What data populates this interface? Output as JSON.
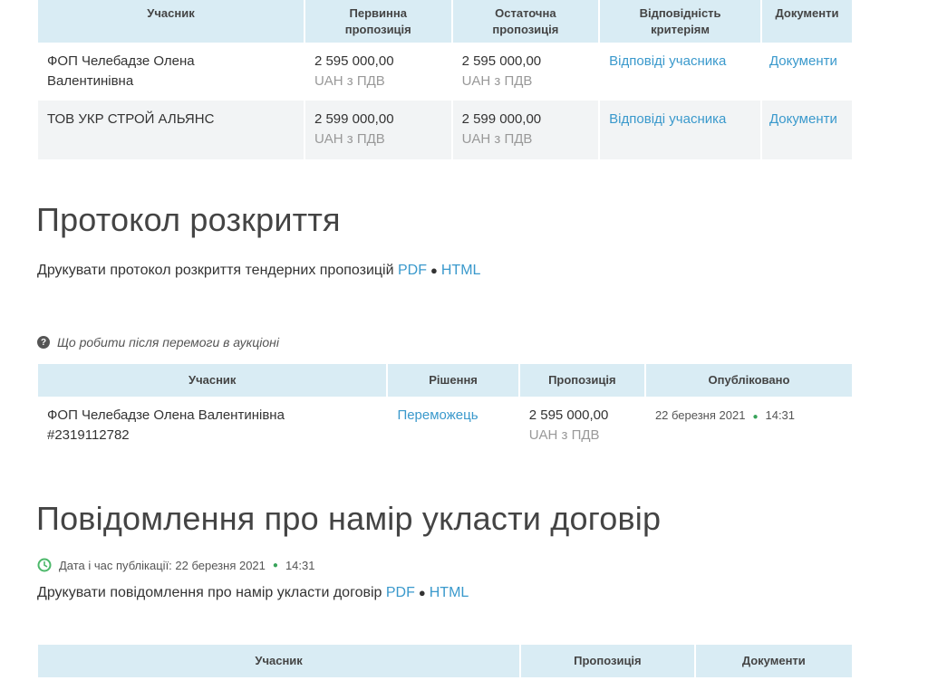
{
  "bids_table": {
    "headers": {
      "participant": "Учасник",
      "initial_1": "Первинна",
      "initial_2": "пропозиція",
      "final_1": "Остаточна",
      "final_2": "пропозиція",
      "criteria_1": "Відповідність",
      "criteria_2": "критеріям",
      "documents": "Документи"
    },
    "rows": [
      {
        "name_1": "ФОП Челебадзе Олена",
        "name_2": "Валентинівна",
        "initial": "2 595 000,00",
        "initial_vat": "UAH з ПДВ",
        "final": "2 595 000,00",
        "final_vat": "UAH з ПДВ",
        "answers": "Відповіді учасника",
        "documents": "Документи"
      },
      {
        "name_1": "ТОВ УКР СТРОЙ АЛЬЯНС",
        "name_2": "",
        "initial": "2 599 000,00",
        "initial_vat": "UAH з ПДВ",
        "final": "2 599 000,00",
        "final_vat": "UAH з ПДВ",
        "answers": "Відповіді учасника",
        "documents": "Документи"
      }
    ]
  },
  "protocol": {
    "title": "Протокол розкриття",
    "print_text": "Друкувати протокол розкриття тендерних пропозицій",
    "pdf": "PDF",
    "sep": "●",
    "html": "HTML"
  },
  "auction_note": {
    "icon": "?",
    "text": "Що робити після перемоги в аукціоні"
  },
  "winner_table": {
    "headers": {
      "participant": "Учасник",
      "decision": "Рішення",
      "offer": "Пропозиція",
      "published": "Опубліковано"
    },
    "row": {
      "name": "ФОП Челебадзе Олена Валентинівна",
      "id": "#2319112782",
      "decision": "Переможець",
      "offer": "2 595 000,00",
      "offer_vat": "UAH з ПДВ",
      "date": "22 березня 2021",
      "time": "14:31"
    }
  },
  "intent": {
    "title": "Повідомлення про намір укласти договір",
    "pub_label": "Дата і час публікації: 22 березня 2021",
    "pub_time": "14:31",
    "print_text": "Друкувати повідомлення про намір укласти договір",
    "pdf": "PDF",
    "sep": "●",
    "html": "HTML"
  },
  "contract_table": {
    "headers": {
      "participant": "Учасник",
      "offer": "Пропозиція",
      "documents": "Документи"
    }
  }
}
